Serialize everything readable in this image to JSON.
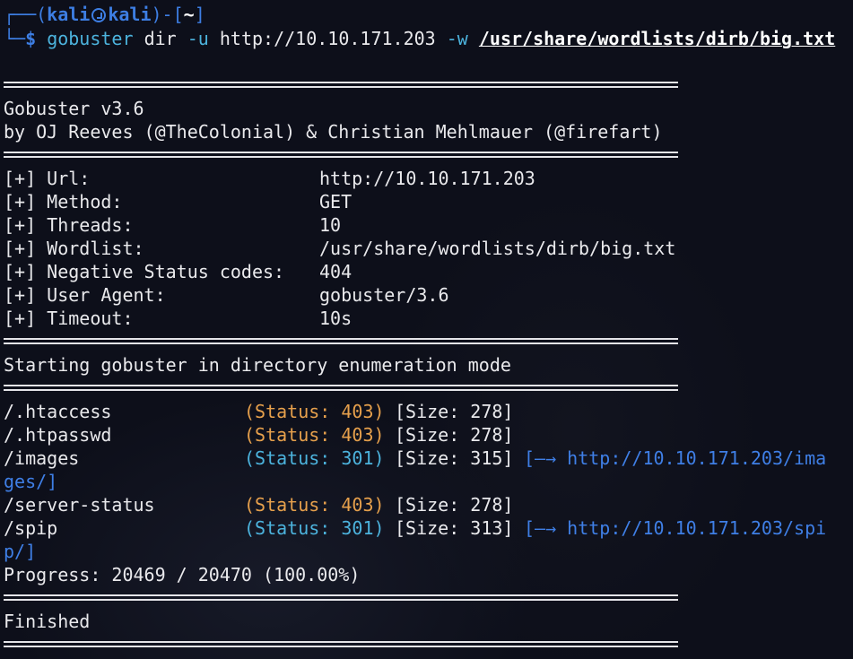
{
  "prompt": {
    "frame_top_left": "┌──(",
    "user": "kali",
    "host": "kali",
    "frame_mid": ")-[",
    "cwd": "~",
    "frame_close": "]",
    "frame_bottom_left": "└─",
    "symbol": "$",
    "command": "gobuster",
    "subcommand": "dir",
    "flag_u": "-u",
    "url_arg": "http://10.10.171.203",
    "flag_w": "-w",
    "wordlist_arg": "/usr/share/wordlists/dirb/big.txt"
  },
  "banner": {
    "title": "Gobuster v3.6",
    "authors": "by OJ Reeves (@TheColonial) & Christian Mehlmauer (@firefart)"
  },
  "config": [
    {
      "label": "[+] Url:",
      "value": "http://10.10.171.203"
    },
    {
      "label": "[+] Method:",
      "value": "GET"
    },
    {
      "label": "[+] Threads:",
      "value": "10"
    },
    {
      "label": "[+] Wordlist:",
      "value": "/usr/share/wordlists/dirb/big.txt"
    },
    {
      "label": "[+] Negative Status codes:",
      "value": "404"
    },
    {
      "label": "[+] User Agent:",
      "value": "gobuster/3.6"
    },
    {
      "label": "[+] Timeout:",
      "value": "10s"
    }
  ],
  "start_message": "Starting gobuster in directory enumeration mode",
  "results": [
    {
      "path": "/.htaccess",
      "status": "(Status: 403)",
      "size": "[Size: 278]",
      "redirect": "",
      "redirect_wrap": ""
    },
    {
      "path": "/.htpasswd",
      "status": "(Status: 403)",
      "size": "[Size: 278]",
      "redirect": "",
      "redirect_wrap": ""
    },
    {
      "path": "/images",
      "status": "(Status: 301)",
      "size": "[Size: 315]",
      "redirect": "[—→ http://10.10.171.203/ima",
      "redirect_wrap": "ges/]"
    },
    {
      "path": "/server-status",
      "status": "(Status: 403)",
      "size": "[Size: 278]",
      "redirect": "",
      "redirect_wrap": ""
    },
    {
      "path": "/spip",
      "status": "(Status: 301)",
      "size": "[Size: 313]",
      "redirect": "[—→ http://10.10.171.203/spi",
      "redirect_wrap": "p/]"
    }
  ],
  "progress": "Progress: 20469 / 20470 (100.00%)",
  "finished": "Finished",
  "colors": {
    "background": "#0d0f1a",
    "text": "#e9e9ec",
    "status_403": "#e6a04c",
    "status_301": "#4cb3dd",
    "redirect_link": "#3f7fe6",
    "prompt": "#3d7ee3"
  }
}
